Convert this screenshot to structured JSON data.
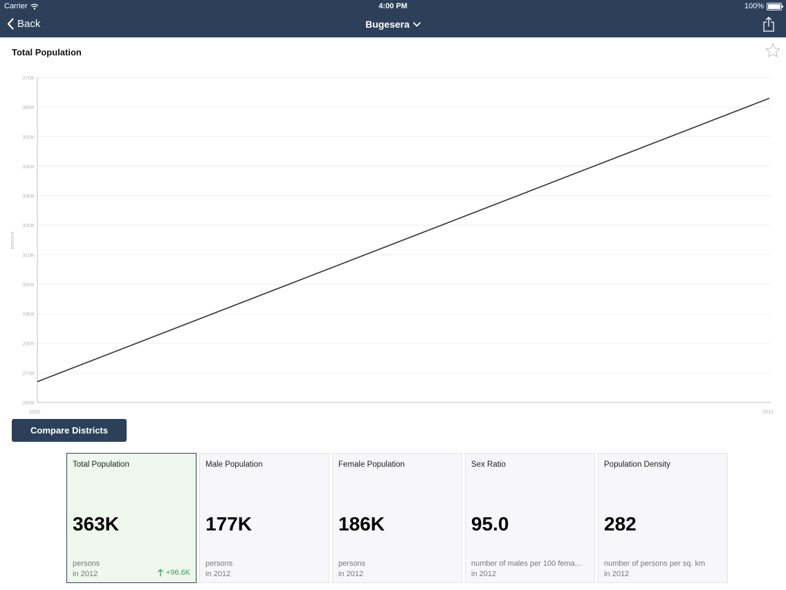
{
  "status_bar": {
    "carrier": "Carrier",
    "time": "4:00 PM",
    "battery": "100%"
  },
  "nav": {
    "back_label": "Back",
    "title": "Bugesera"
  },
  "chart_header": {
    "title": "Total Population"
  },
  "chart_data": {
    "type": "line",
    "x": [
      2002,
      2012
    ],
    "series": [
      {
        "values": [
          267000,
          363000
        ]
      }
    ],
    "ylabel": "persons",
    "ylim": [
      260000,
      370000
    ],
    "yticks": [
      "260K",
      "270K",
      "280K",
      "290K",
      "300K",
      "310K",
      "320K",
      "330K",
      "340K",
      "350K",
      "360K",
      "370K"
    ],
    "xticks": [
      "2002",
      "2012"
    ],
    "grid": true,
    "line_color": "#333333"
  },
  "compare_button": {
    "label": "Compare Districts"
  },
  "cards": [
    {
      "title": "Total Population",
      "value": "363K",
      "unit": "persons",
      "year": "in 2012",
      "change": "+96.6K",
      "selected": true
    },
    {
      "title": "Male Population",
      "value": "177K",
      "unit": "persons",
      "year": "in 2012"
    },
    {
      "title": "Female Population",
      "value": "186K",
      "unit": "persons",
      "year": "in 2012"
    },
    {
      "title": "Sex Ratio",
      "value": "95.0",
      "unit": "number of males per 100 fema...",
      "year": "in 2012"
    },
    {
      "title": "Population Density",
      "value": "282",
      "unit": "number of persons per sq. km",
      "year": "in 2012"
    }
  ],
  "colors": {
    "navbar": "#2c4059",
    "accent_green": "#3f9b56",
    "selected_card": "#eef8ec"
  },
  "icons": [
    "wifi-icon",
    "battery-icon",
    "chevron-left-icon",
    "chevron-down-icon",
    "share-icon",
    "star-icon",
    "arrow-up-icon"
  ]
}
